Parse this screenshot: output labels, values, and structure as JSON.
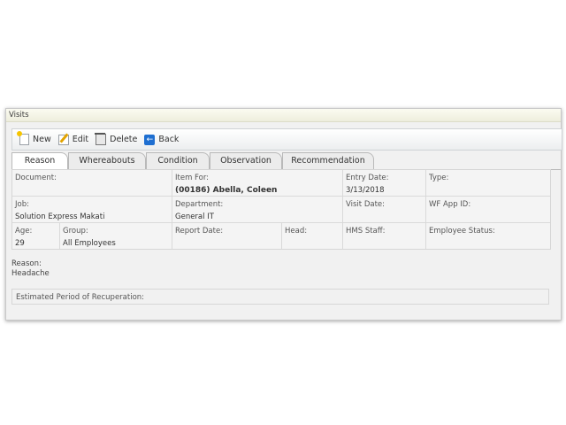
{
  "panel": {
    "title": "Visits"
  },
  "toolbar": {
    "new_label": "New",
    "edit_label": "Edit",
    "delete_label": "Delete",
    "back_label": "Back"
  },
  "tabs": [
    "Reason",
    "Whereabouts",
    "Condition",
    "Observation",
    "Recommendation"
  ],
  "active_tab": "Reason",
  "fields": {
    "document": {
      "label": "Document:",
      "value": ""
    },
    "item_for": {
      "label": "Item For:",
      "value": "(00186) Abella, Coleen"
    },
    "entry_date": {
      "label": "Entry Date:",
      "value": "3/13/2018"
    },
    "type": {
      "label": "Type:",
      "value": ""
    },
    "job": {
      "label": "Job:",
      "value": "Solution Express Makati"
    },
    "department": {
      "label": "Department:",
      "value": "General IT"
    },
    "visit_date": {
      "label": "Visit Date:",
      "value": ""
    },
    "wf_app_id": {
      "label": "WF App ID:",
      "value": ""
    },
    "age": {
      "label": "Age:",
      "value": "29"
    },
    "group": {
      "label": "Group:",
      "value": "All Employees"
    },
    "report_date": {
      "label": "Report Date:",
      "value": ""
    },
    "head": {
      "label": "Head:",
      "value": ""
    },
    "hms_staff": {
      "label": "HMS Staff:",
      "value": ""
    },
    "employee_status": {
      "label": "Employee Status:",
      "value": ""
    }
  },
  "reason": {
    "label": "Reason:",
    "value": "Headache"
  },
  "recuperation": {
    "label": "Estimated Period of Recuperation:"
  },
  "colors": {
    "back_icon": "#1f6fd1",
    "header_bg": "#f6f6e8"
  }
}
